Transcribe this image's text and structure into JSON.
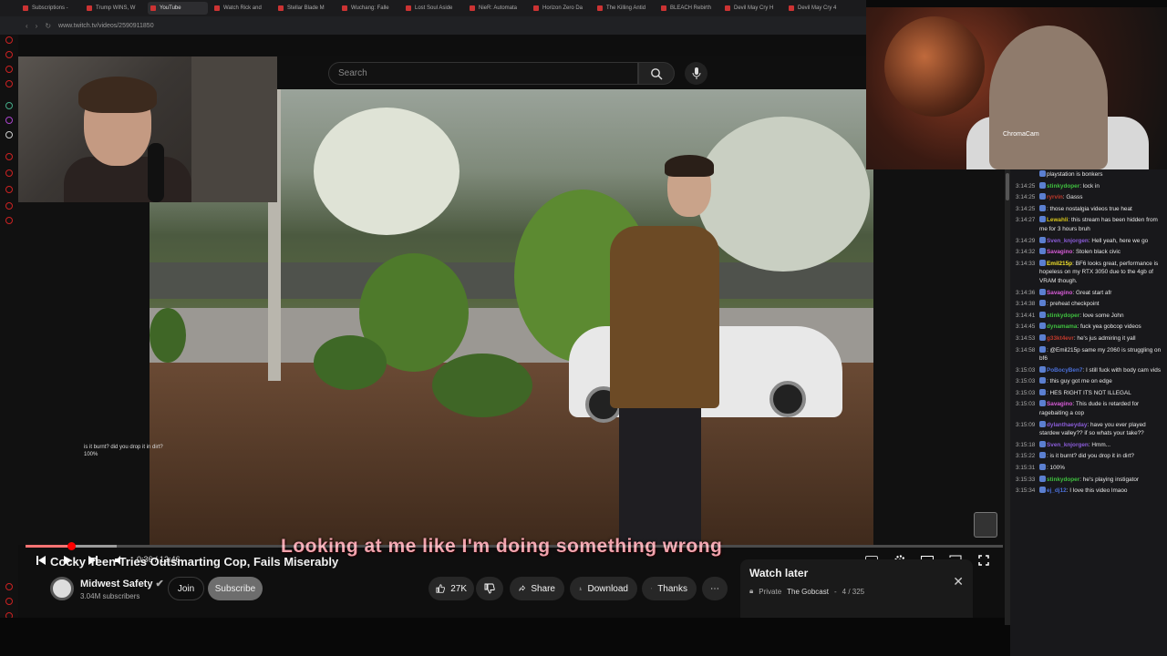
{
  "browser": {
    "tabs": [
      {
        "label": "Subscriptions - "
      },
      {
        "label": "Trump WINS, W"
      },
      {
        "label": "YouTube"
      },
      {
        "label": "Watch Rick and"
      },
      {
        "label": "Stellar Blade M"
      },
      {
        "label": "Wuchang: Falle"
      },
      {
        "label": "Lost Soul Aside"
      },
      {
        "label": "NieR: Automata"
      },
      {
        "label": "Horizon Zero Da"
      },
      {
        "label": "The Killing Antid"
      },
      {
        "label": "BLEACH Rebirth"
      },
      {
        "label": "Devil May Cry H"
      },
      {
        "label": "Devil May Cry 4"
      }
    ],
    "url": "www.twitch.tv/videos/2590911850"
  },
  "youtube": {
    "search_placeholder": "Search",
    "subtitle": "Looking at me like I'm doing something wrong",
    "time": "0:36 / 12:46",
    "progress_fraction": 0.047,
    "video_title": "Cocky Teen Tries Outsmarting Cop, Fails Miserably",
    "channel": {
      "name": "Midwest Safety",
      "subs": "3.04M subscribers"
    },
    "join_label": "Join",
    "subscribe_label": "Subscribe",
    "like_count": "27K",
    "share_label": "Share",
    "download_label": "Download",
    "thanks_label": "Thanks",
    "more_label": "⋯",
    "watch_later": {
      "title": "Watch later",
      "privacy": "Private",
      "channel": "The Gobcast",
      "position": "4 / 325"
    },
    "overlay_chat": [
      {
        "text": "is it burnt? did you drop it in dirt?"
      },
      {
        "text": "100%"
      }
    ]
  },
  "webcam": {
    "label": "ChromaCam"
  },
  "chat": {
    "messages": [
      {
        "ts": "",
        "user": "",
        "color": "#9e9e9e",
        "text": "playstation is bonkers"
      },
      {
        "ts": "3:14:25",
        "user": "stinkydoper",
        "color": "#3fbf3f",
        "text": ": lock in"
      },
      {
        "ts": "3:14:25",
        "user": "ryrvin",
        "color": "#c0392b",
        "text": ": Gasss"
      },
      {
        "ts": "3:14:25",
        "user": "",
        "color": "#4a6fd8",
        "text": ": those nostalgia videos true heat"
      },
      {
        "ts": "3:14:27",
        "user": "Lewahli",
        "color": "#d4c21c",
        "text": ": this stream has been hidden from me for 3 hours bruh"
      },
      {
        "ts": "3:14:29",
        "user": "Sven_knjorgen",
        "color": "#8a5cd8",
        "text": ": Hell yeah, here we go"
      },
      {
        "ts": "3:14:32",
        "user": "Savagino",
        "color": "#d85cd8",
        "text": ": Stolen black civic"
      },
      {
        "ts": "3:14:33",
        "user": "Emil215p",
        "color": "#f0e02c",
        "text": ": BF6 looks great, performance is hopeless on my RTX 3050 due to the 4gb of VRAM though."
      },
      {
        "ts": "3:14:36",
        "user": "Savagino",
        "color": "#d85cd8",
        "text": ": Great start afr"
      },
      {
        "ts": "3:14:38",
        "user": "",
        "color": "#7a2a2a",
        "text": ": preheat checkpoint"
      },
      {
        "ts": "3:14:41",
        "user": "stinkydoper",
        "color": "#3fbf3f",
        "text": ": love some John"
      },
      {
        "ts": "3:14:45",
        "user": "dynamama",
        "color": "#3fbf3f",
        "text": ": fuck yea gobcop videos"
      },
      {
        "ts": "3:14:53",
        "user": "g33kt4evr",
        "color": "#c0392b",
        "text": ": he's jus admiring it yall"
      },
      {
        "ts": "3:14:58",
        "user": "",
        "color": "#7a2a2a",
        "text": ": @Emil215p same my 2060 is struggling on bf6"
      },
      {
        "ts": "3:15:03",
        "user": "PoBocyBen7",
        "color": "#4a6fd8",
        "text": ": I still fuck with body cam vids"
      },
      {
        "ts": "3:15:03",
        "user": "",
        "color": "#4a6fd8",
        "text": ": this guy got me on edge"
      },
      {
        "ts": "3:15:03",
        "user": "",
        "color": "#4a6fd8",
        "text": ": HES RIGHT ITS NOT ILLEGAL"
      },
      {
        "ts": "3:15:03",
        "user": "Savagino",
        "color": "#d85cd8",
        "text": ": This dude is retarded for ragebaiting a cop"
      },
      {
        "ts": "3:15:09",
        "user": "dylanthaeyday",
        "color": "#8a5cd8",
        "text": ": have you ever played stardew valley?? if so whats your take??"
      },
      {
        "ts": "3:15:18",
        "user": "Sven_knjorgen",
        "color": "#8a5cd8",
        "text": ": Hmm..."
      },
      {
        "ts": "3:15:22",
        "user": "",
        "color": "#7a2a2a",
        "text": ": is it burnt? did you drop it in dirt?"
      },
      {
        "ts": "3:15:31",
        "user": "",
        "color": "#4a6fd8",
        "text": ": 100%"
      },
      {
        "ts": "3:15:33",
        "user": "stinkydoper",
        "color": "#3fbf3f",
        "text": ": he's playing instigator"
      },
      {
        "ts": "3:15:34",
        "user": "ej_dj12",
        "color": "#4a6fd8",
        "text": ": I love this video lmaoo"
      }
    ]
  },
  "colors": {
    "accent": "#ff0000",
    "subtitle": "#f1a3ad",
    "chat_bg": "#18181b"
  }
}
